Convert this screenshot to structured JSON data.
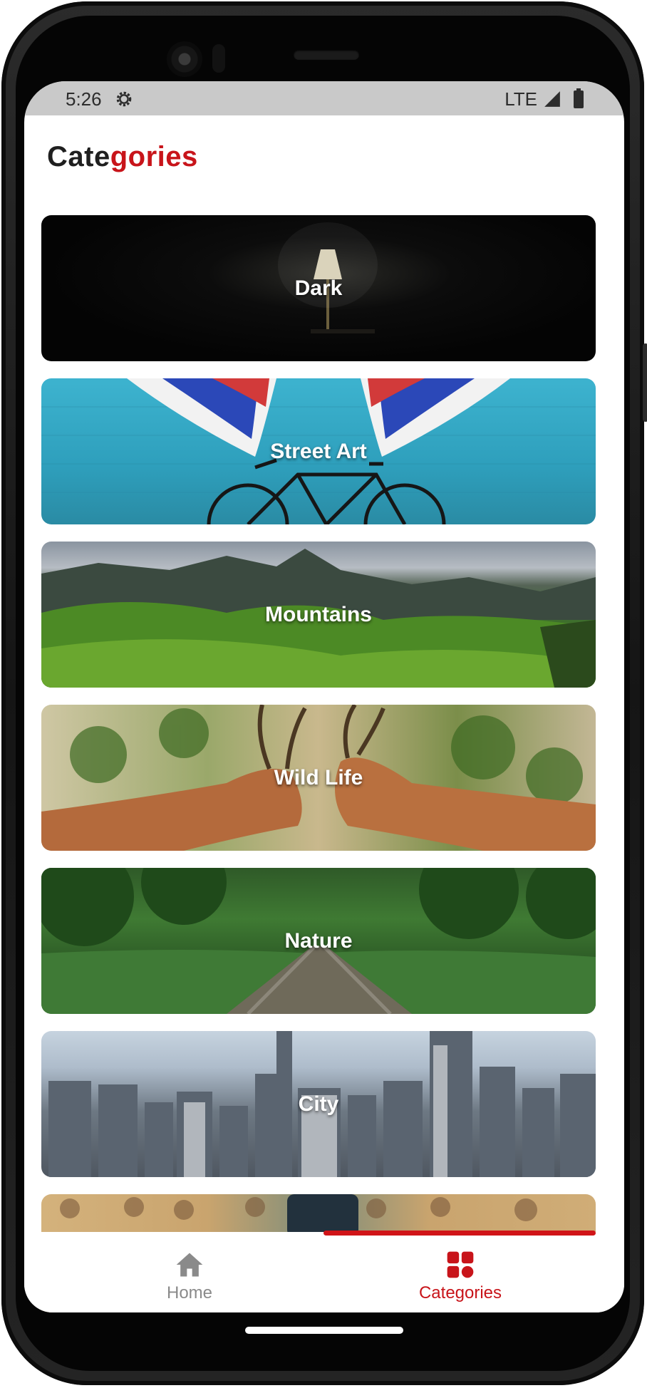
{
  "status_bar": {
    "time": "5:26",
    "network": "LTE",
    "icons": [
      "settings-gear-icon",
      "signal-icon",
      "battery-icon"
    ]
  },
  "page": {
    "title_part1": "Cate",
    "title_part2": "gories",
    "accent_color": "#c8141a"
  },
  "categories": [
    {
      "label": "Dark"
    },
    {
      "label": "Street Art"
    },
    {
      "label": "Mountains"
    },
    {
      "label": "Wild Life"
    },
    {
      "label": "Nature"
    },
    {
      "label": "City"
    },
    {
      "label": ""
    }
  ],
  "bottom_nav": {
    "items": [
      {
        "label": "Home",
        "icon": "home-icon",
        "active": false
      },
      {
        "label": "Categories",
        "icon": "categories-grid-icon",
        "active": true
      }
    ]
  }
}
